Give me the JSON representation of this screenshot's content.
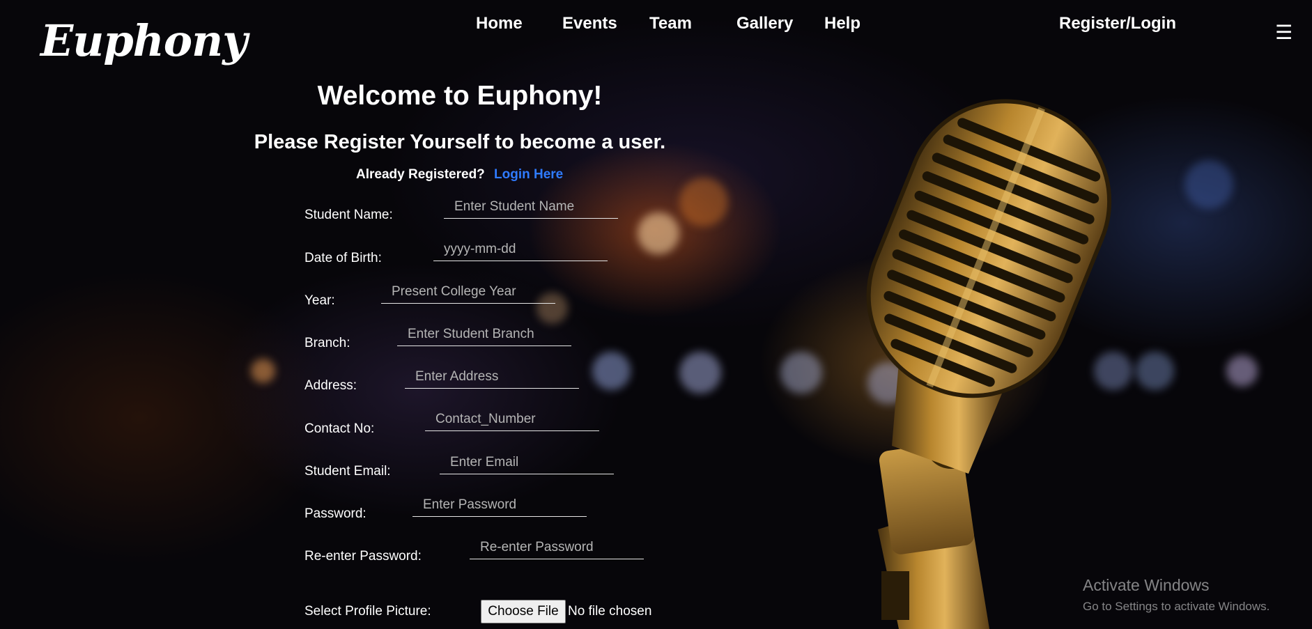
{
  "header": {
    "logo_text": "Euphony",
    "nav": {
      "home": "Home",
      "events": "Events",
      "team": "Team",
      "gallery": "Gallery",
      "help": "Help",
      "register_login": "Register/Login"
    },
    "menu_glyph": "☰"
  },
  "intro": {
    "welcome": "Welcome to Euphony!",
    "subtitle": "Please Register Yourself to become a user.",
    "already_registered": "Already Registered?",
    "login_link": "Login Here"
  },
  "form": {
    "student_name": {
      "label": "Student Name:",
      "placeholder": "Enter Student Name",
      "value": ""
    },
    "dob": {
      "label": "Date of Birth:",
      "placeholder": "yyyy-mm-dd",
      "value": ""
    },
    "year": {
      "label": "Year:",
      "placeholder": "Present College Year",
      "value": ""
    },
    "branch": {
      "label": "Branch:",
      "placeholder": "Enter Student Branch",
      "value": ""
    },
    "address": {
      "label": "Address:",
      "placeholder": "Enter Address",
      "value": ""
    },
    "contact": {
      "label": "Contact No:",
      "placeholder": "Contact_Number",
      "value": ""
    },
    "email": {
      "label": "Student Email:",
      "placeholder": "Enter Email",
      "value": ""
    },
    "password": {
      "label": "Password:",
      "placeholder": "Enter Password",
      "value": ""
    },
    "reenter_password": {
      "label": "Re-enter Password:",
      "placeholder": "Re-enter Password",
      "value": ""
    },
    "profile_picture": {
      "label": "Select Profile Picture:",
      "button": "Choose File",
      "status": "No file chosen"
    }
  },
  "watermark": {
    "title": "Activate Windows",
    "subtitle": "Go to Settings to activate Windows."
  },
  "colors": {
    "background": "#07060a",
    "link": "#2f7bff",
    "text": "#ffffff",
    "placeholder": "#b5b5b5"
  },
  "icons": {
    "menu": "hamburger-icon",
    "hero": "microphone-icon"
  }
}
